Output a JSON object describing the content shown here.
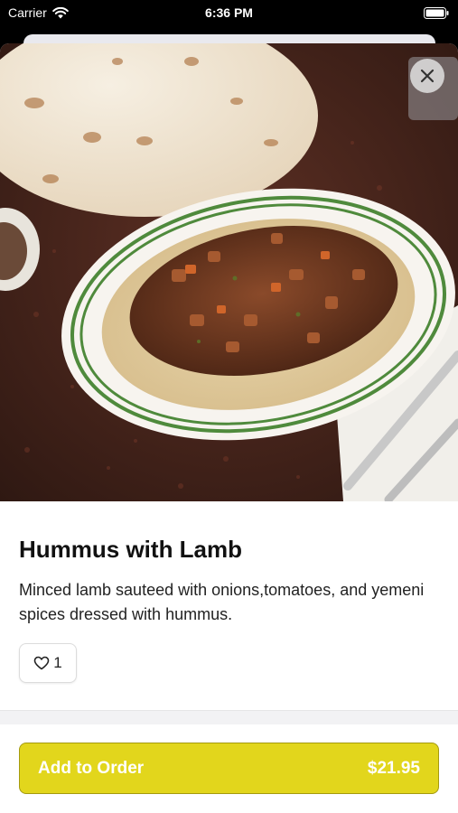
{
  "status_bar": {
    "carrier": "Carrier",
    "time": "6:36 PM"
  },
  "item": {
    "title": "Hummus with Lamb",
    "description": "Minced lamb sauteed with onions,tomatoes, and yemeni spices dressed with hummus.",
    "likes": "1"
  },
  "order": {
    "label": "Add to Order",
    "price": "$21.95"
  },
  "colors": {
    "accent": "#e2d61c",
    "accent_border": "#a49a10"
  }
}
